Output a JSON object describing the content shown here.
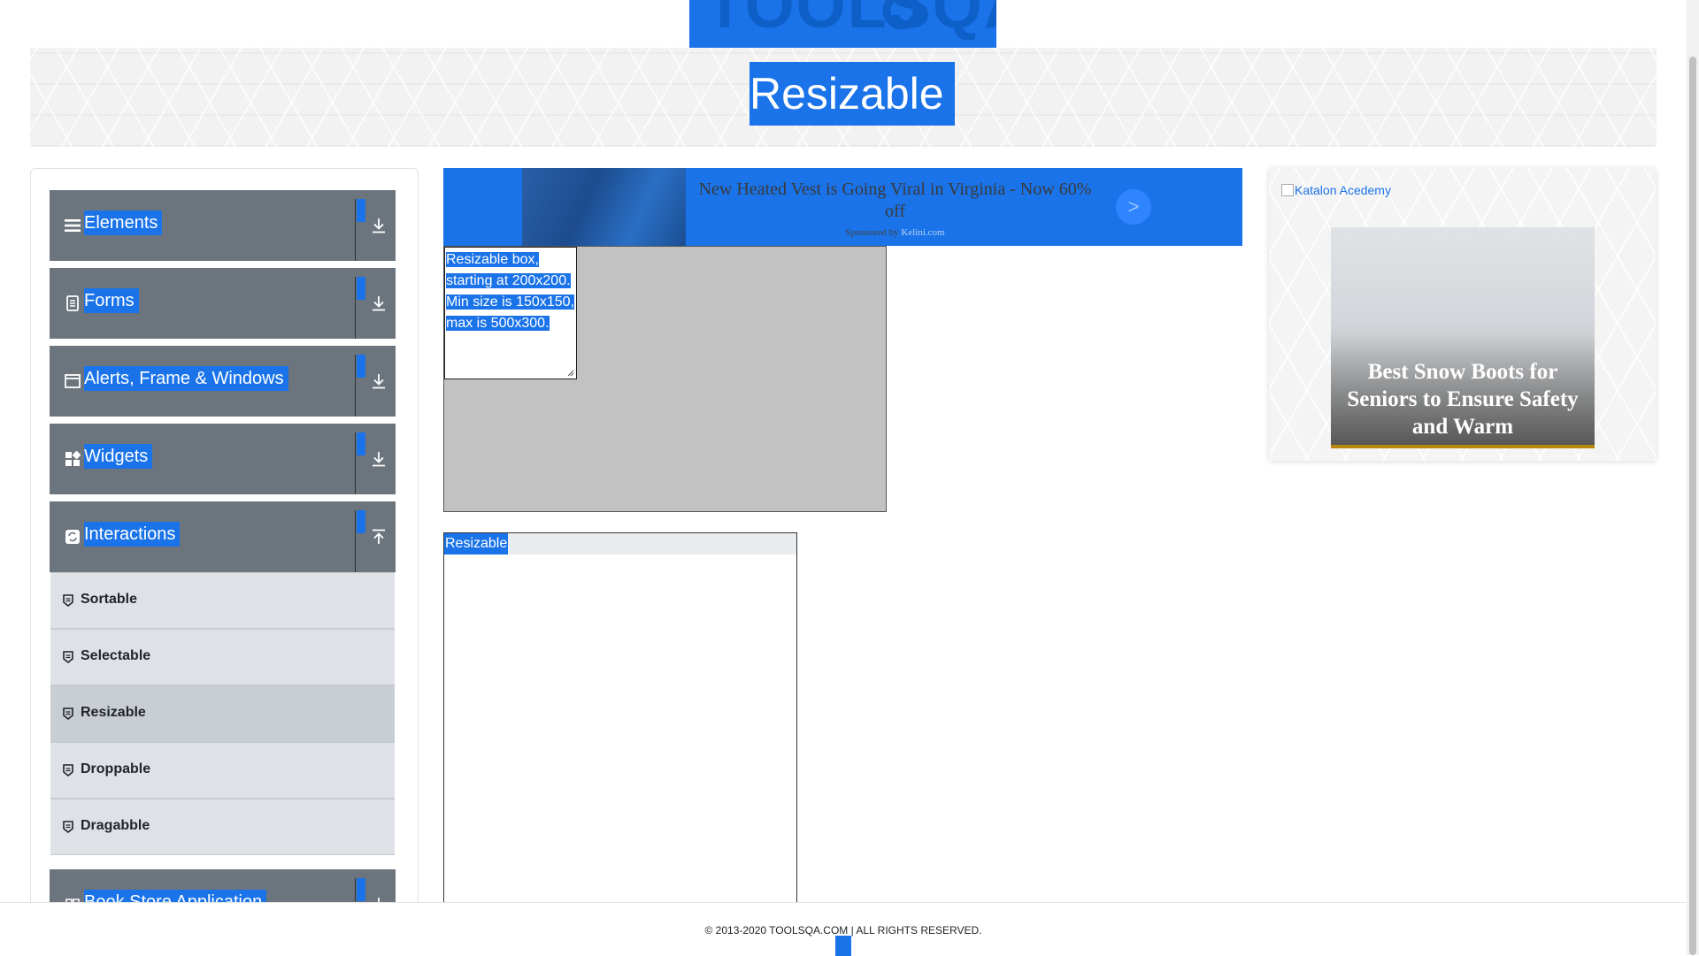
{
  "header": {
    "logo_text": "TOOLSQA",
    "page_title": "Resizable"
  },
  "sidebar": {
    "groups": [
      {
        "label": "Elements",
        "icon": "menu-icon",
        "expanded": false
      },
      {
        "label": "Forms",
        "icon": "document-icon",
        "expanded": false
      },
      {
        "label": "Alerts, Frame & Windows",
        "icon": "window-icon",
        "expanded": false
      },
      {
        "label": "Widgets",
        "icon": "widgets-icon",
        "expanded": false
      },
      {
        "label": "Interactions",
        "icon": "interactions-icon",
        "expanded": true
      },
      {
        "label": "Book Store Application",
        "icon": "book-icon",
        "expanded": false
      }
    ],
    "interaction_items": [
      {
        "label": "Sortable",
        "active": false
      },
      {
        "label": "Selectable",
        "active": false
      },
      {
        "label": "Resizable",
        "active": true
      },
      {
        "label": "Droppable",
        "active": false
      },
      {
        "label": "Dragabble",
        "active": false
      }
    ]
  },
  "ad_banner": {
    "title": "New Heated Vest is Going Viral in Virginia - Now 60% off",
    "sponsored_by": "Sponsored by",
    "sponsor": "Kelini.com",
    "button": ">"
  },
  "resizable_with_restriction": {
    "text_lines": [
      "Resizable box,",
      "starting at 200x200.",
      "Min size is 150x150,",
      "max is 500x300."
    ]
  },
  "resizable_free": {
    "label": "Resizable"
  },
  "right_ad": {
    "link_text": "Katalon Acedemy",
    "caption": "Best Snow Boots for Seniors to Ensure Safety and Warm"
  },
  "footer": {
    "copyright": "© 2013-2020 TOOLSQA.COM | ALL RIGHTS RESERVED."
  },
  "colors": {
    "accent": "#1a73e8",
    "sidebar_header": "#6c757d",
    "sidebar_item": "#dee2e6"
  }
}
